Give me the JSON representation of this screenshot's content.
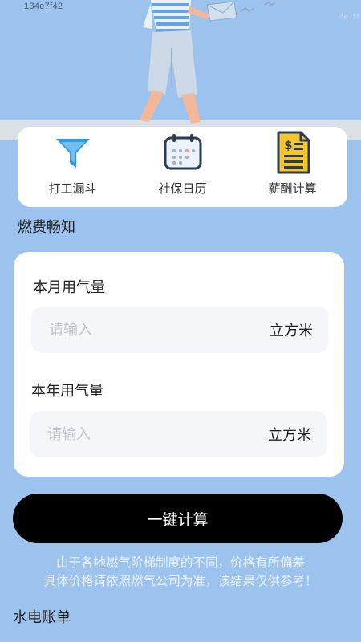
{
  "watermark": {
    "left": "134e7f42",
    "right": "4e7f4"
  },
  "tools": [
    {
      "label": "打工漏斗",
      "icon": "funnel-icon"
    },
    {
      "label": "社保日历",
      "icon": "calendar-icon"
    },
    {
      "label": "薪酬计算",
      "icon": "salary-document-icon"
    }
  ],
  "gas": {
    "section_title": "燃费畅知",
    "monthly": {
      "label": "本月用气量",
      "placeholder": "请输入",
      "value": "",
      "unit": "立方米"
    },
    "yearly": {
      "label": "本年用气量",
      "placeholder": "请输入",
      "value": "",
      "unit": "立方米"
    },
    "button_label": "一键计算",
    "notice_line1": "由于各地燃气阶梯制度的不同，价格有所偏差",
    "notice_line2": "具体价格请依照燃气公司为准，该结果仅供参考！"
  },
  "bill_section_title": "水电账单",
  "colors": {
    "background": "#9cc3ee",
    "card": "#ffffff",
    "button": "#000000",
    "funnel": "#2f9be8",
    "calendar_frame": "#2a3b55",
    "document": "#f5c52a"
  }
}
